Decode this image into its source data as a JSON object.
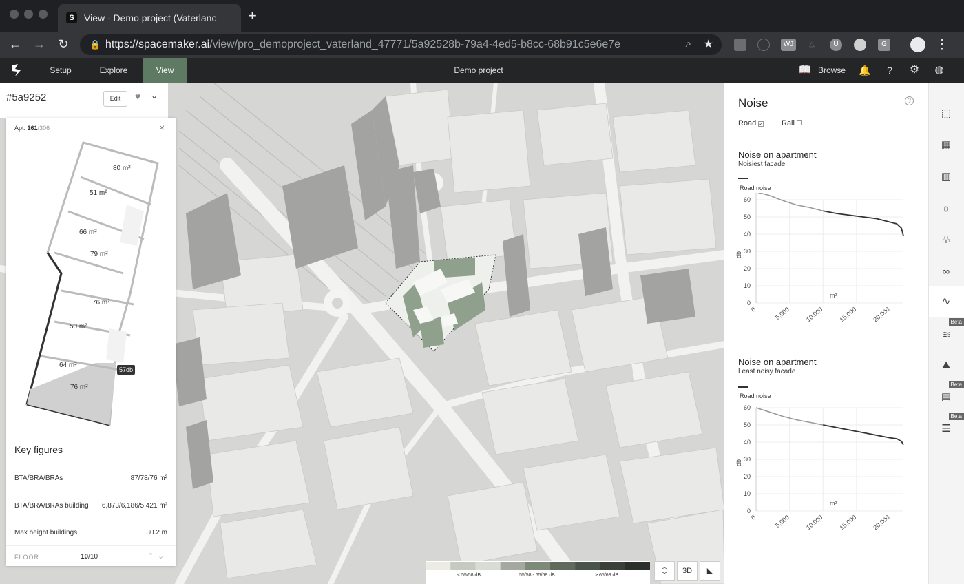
{
  "browser": {
    "tab_title": "View - Demo project (Vaterlanc",
    "new_tab": "+",
    "url_host": "https://spacemaker.ai",
    "url_path": "/view/pro_demoproject_vaterland_47771/5a92528b-79a4-4ed5-b8cc-68b91c5e6e7e",
    "ext_labels": [
      "WJ",
      "G"
    ]
  },
  "app": {
    "nav": [
      "Setup",
      "Explore",
      "View"
    ],
    "project_title": "Demo project",
    "browse": "Browse"
  },
  "left": {
    "proposal_id": "#5a9252",
    "edit": "Edit",
    "apt_label": "Apt.",
    "apt_current": "161",
    "apt_total": "/306",
    "rooms": [
      "80 m²",
      "51 m²",
      "66 m²",
      "79 m²",
      "76 m²",
      "50 m²",
      "64 m²",
      "76 m²"
    ],
    "db_tag": "57db",
    "key_figures_title": "Key figures",
    "rows": [
      {
        "label": "BTA/BRA/BRAs",
        "value": "87/78/76 m²"
      },
      {
        "label": "BTA/BRA/BRAs building",
        "value": "6,873/6,186/5,421 m²"
      },
      {
        "label": "Max height buildings",
        "value": "30.2 m"
      }
    ],
    "floor_label": "FLOOR",
    "floor_current": "10",
    "floor_total": "/10"
  },
  "noise": {
    "title": "Noise",
    "road": "Road",
    "rail": "Rail",
    "charts": [
      {
        "title": "Noise on apartment",
        "subtitle": "Noisiest facade",
        "legend": "Road noise",
        "ylabel": "db",
        "xlabel": "m²"
      },
      {
        "title": "Noise on apartment",
        "subtitle": "Least noisy facade",
        "legend": "Road noise",
        "ylabel": "db",
        "xlabel": "m²"
      }
    ]
  },
  "chart_data": [
    {
      "type": "line",
      "title": "Noise on apartment",
      "subtitle": "Noisiest facade",
      "ylabel": "db",
      "xlabel": "m²",
      "ylim": [
        0,
        60
      ],
      "xlim": [
        0,
        22000
      ],
      "yticks": [
        "0",
        "10",
        "20",
        "30",
        "40",
        "50",
        "60"
      ],
      "xticks": [
        "0",
        "5,000",
        "10,000",
        "15,000",
        "20,000"
      ],
      "series": [
        {
          "name": "Road noise",
          "x": [
            0,
            2000,
            4000,
            6000,
            8000,
            10000,
            12000,
            14000,
            16000,
            18000,
            20000,
            21000,
            21700,
            22000
          ],
          "y": [
            64.5,
            62.5,
            59.5,
            57,
            55.5,
            53.5,
            52,
            51,
            50,
            49,
            47,
            46,
            43.5,
            39
          ]
        }
      ]
    },
    {
      "type": "line",
      "title": "Noise on apartment",
      "subtitle": "Least noisy facade",
      "ylabel": "db",
      "xlabel": "m²",
      "ylim": [
        0,
        60
      ],
      "xlim": [
        0,
        22000
      ],
      "yticks": [
        "0",
        "10",
        "20",
        "30",
        "40",
        "50",
        "60"
      ],
      "xticks": [
        "0",
        "5,000",
        "10,000",
        "15,000",
        "20,000"
      ],
      "series": [
        {
          "name": "Road noise",
          "x": [
            0,
            2000,
            4000,
            6000,
            8000,
            10000,
            12000,
            14000,
            16000,
            18000,
            20000,
            21000,
            21700,
            22000
          ],
          "y": [
            60,
            57.5,
            55,
            53,
            51.5,
            50,
            48.5,
            47,
            45.5,
            44,
            42.5,
            42,
            40.5,
            38.5
          ]
        }
      ]
    }
  ],
  "legend": {
    "labels": [
      "< 55/58 dB",
      "55/58 - 65/68 dB",
      "> 65/68 dB"
    ],
    "colors": [
      "#ecece5",
      "#c6c9c0",
      "#d9dcd5",
      "#a4a8a0",
      "#7d8a7a",
      "#5f6a5c",
      "#4b544a",
      "#3a3f39",
      "#2c302b"
    ]
  },
  "view_buttons": [
    "3D"
  ],
  "sidebar": {
    "betas": [
      "Beta",
      "Beta",
      "Beta"
    ]
  },
  "colors": {
    "accent": "#5f7a62",
    "chart_gray": "#999999",
    "chart_dark": "#333333"
  }
}
